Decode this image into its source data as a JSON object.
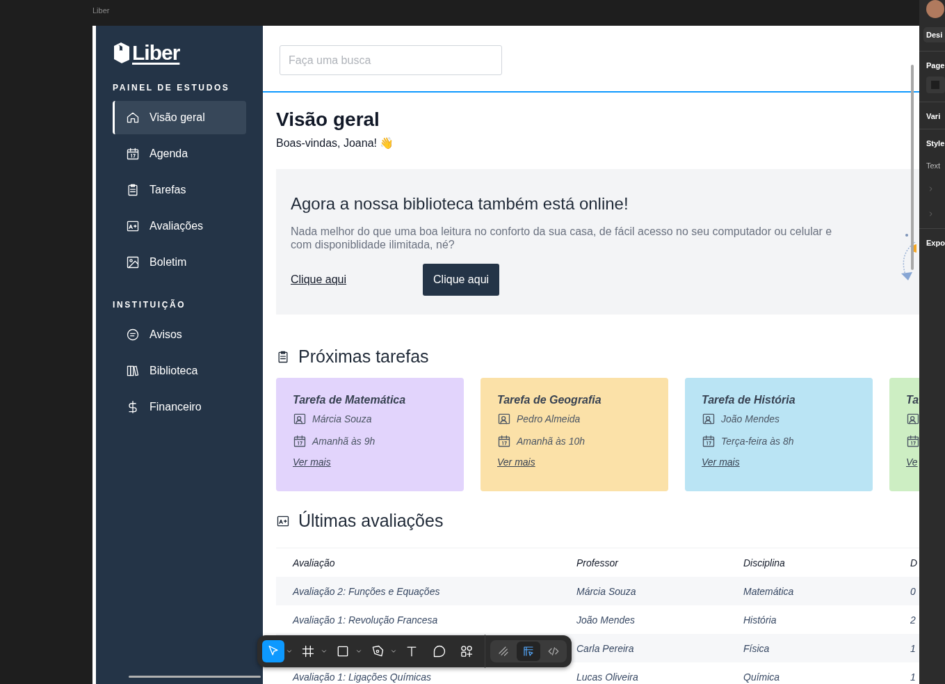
{
  "editor": {
    "frame_label": "Liber",
    "right_panel": [
      {
        "kind": "tab",
        "label": "Desi"
      },
      {
        "kind": "section",
        "label": "Page"
      },
      {
        "kind": "swatch"
      },
      {
        "kind": "section",
        "label": "Vari"
      },
      {
        "kind": "section",
        "label": "Style"
      },
      {
        "kind": "sub",
        "label": "Text"
      },
      {
        "kind": "chevron"
      },
      {
        "kind": "chevron"
      },
      {
        "kind": "section",
        "label": "Expo"
      }
    ],
    "toolbar": {
      "tools": [
        {
          "kind": "move",
          "selected": true
        },
        {
          "kind": "frame",
          "selected": false
        },
        {
          "kind": "shape",
          "selected": false
        },
        {
          "kind": "pen",
          "selected": false
        },
        {
          "kind": "text",
          "selected": false
        },
        {
          "kind": "comment",
          "selected": false
        },
        {
          "kind": "actions",
          "selected": false
        }
      ],
      "modes": [
        {
          "kind": "draw",
          "selected": false
        },
        {
          "kind": "design",
          "selected": true
        },
        {
          "kind": "dev",
          "selected": false
        }
      ]
    }
  },
  "app": {
    "logo": "Liber",
    "sidebar": [
      {
        "title": "PAINEL DE ESTUDOS",
        "items": [
          {
            "label": "Visão geral",
            "selected": true
          },
          {
            "label": "Agenda",
            "selected": false
          },
          {
            "label": "Tarefas",
            "selected": false
          },
          {
            "label": "Avaliações",
            "selected": false
          },
          {
            "label": "Boletim",
            "selected": false
          }
        ]
      },
      {
        "title": "INSTITUIÇÃO",
        "items": [
          {
            "label": "Avisos",
            "selected": false
          },
          {
            "label": "Biblioteca",
            "selected": false
          },
          {
            "label": "Financeiro",
            "selected": false
          }
        ]
      }
    ],
    "search": {
      "placeholder": "Faça uma busca"
    },
    "heading": "Visão geral",
    "welcome": "Boas-vindas, Joana! 👋",
    "banner": {
      "title": "Agora a nossa biblioteca também está online!",
      "text": "Nada melhor do que uma boa leitura no conforto da sua casa, de fácil acesso no seu computador ou celular e com disponiblidade ilimitada, né?",
      "link": "Clique aqui",
      "button": "Clique aqui"
    },
    "tasks": {
      "title": "Próximas tarefas",
      "cards": [
        {
          "title": "Tarefa de Matemática",
          "teacher": "Márcia Souza",
          "when": "Amanhã às 9h",
          "link": "Ver mais",
          "color": "#e2d4fc"
        },
        {
          "title": "Tarefa de Geografia",
          "teacher": "Pedro Almeida",
          "when": "Amanhã às 10h",
          "link": "Ver mais",
          "color": "#fbe1a8"
        },
        {
          "title": "Tarefa de História",
          "teacher": "João Mendes",
          "when": "Terça-feira às 8h",
          "link": "Ver mais",
          "color": "#bae4f4"
        },
        {
          "title": "Ta",
          "link": "Ve",
          "color": "#cdeec3"
        }
      ]
    },
    "evaluations": {
      "title": "Últimas avaliações",
      "columns": [
        "Avaliação",
        "Professor",
        "Disciplina",
        "D"
      ],
      "rows": [
        [
          "Avaliação 2: Funções e Equações",
          "Márcia Souza",
          "Matemática",
          "0"
        ],
        [
          "Avaliação 1: Revolução Francesa",
          "João Mendes",
          "História",
          "2"
        ],
        [
          null,
          "Carla Pereira",
          "Física",
          "1"
        ],
        [
          "Avaliação 1: Ligações Químicas",
          "Lucas Oliveira",
          "Química",
          "1"
        ]
      ]
    }
  }
}
